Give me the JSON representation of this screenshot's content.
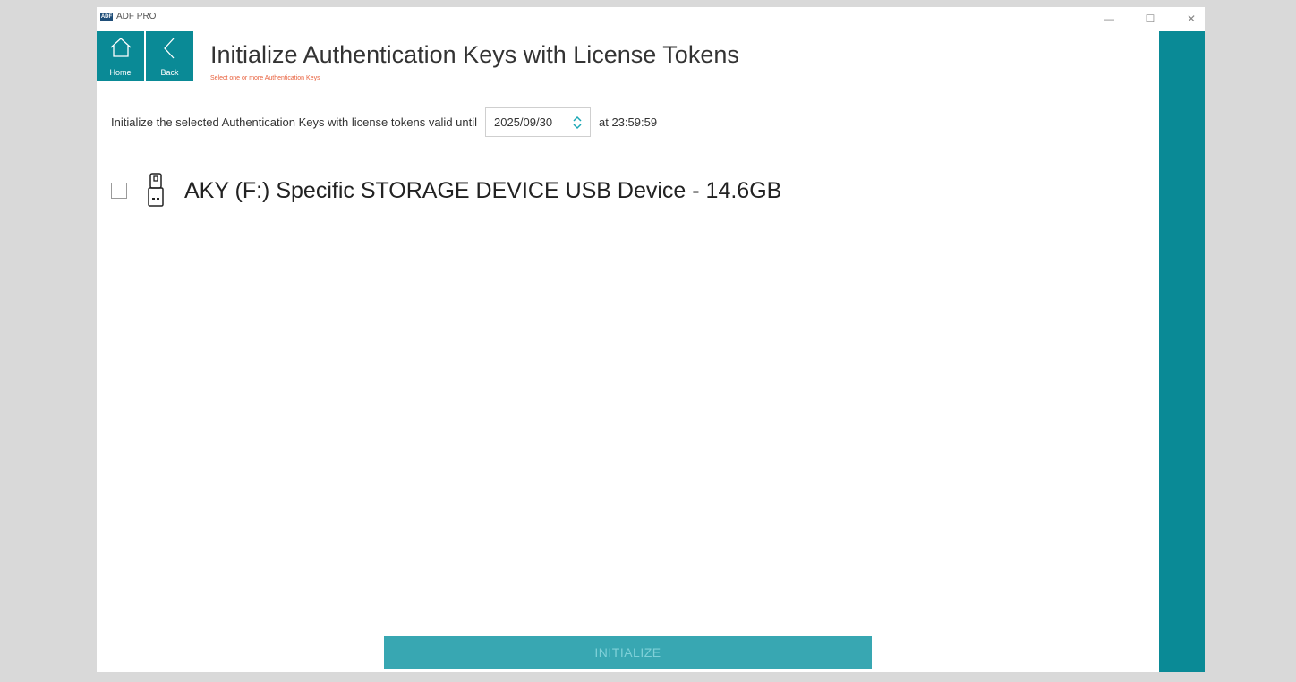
{
  "window": {
    "app_title": "ADF PRO",
    "logo_text": "ADF",
    "controls": {
      "minimize": "—",
      "maximize": "☐",
      "close": "✕"
    }
  },
  "nav": {
    "home_label": "Home",
    "back_label": "Back"
  },
  "header": {
    "title": "Initialize Authentication Keys with License Tokens",
    "subtitle": "Select one or more Authentication Keys"
  },
  "validity": {
    "prefix": "Initialize the selected Authentication Keys with license tokens valid until",
    "date_value": "2025/09/30",
    "suffix": "at 23:59:59"
  },
  "devices": [
    {
      "label": "AKY (F:) Specific STORAGE DEVICE USB Device - 14.6GB",
      "checked": false,
      "icon": "usb-drive-icon"
    }
  ],
  "actions": {
    "initialize_label": "INITIALIZE"
  },
  "colors": {
    "accent": "#0a8a96",
    "subtitle": "#e8603c",
    "button_disabled": "#38a7b2"
  }
}
